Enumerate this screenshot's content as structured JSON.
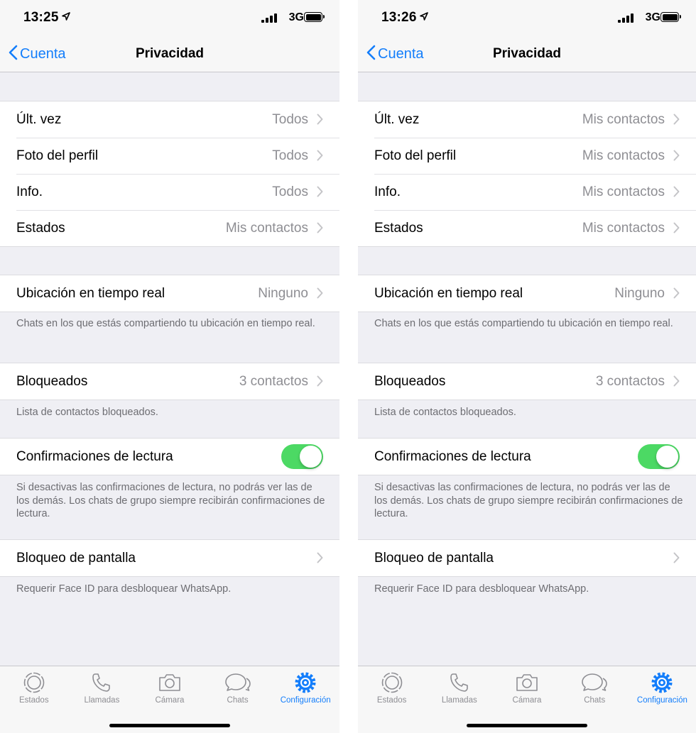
{
  "screens": [
    {
      "time": "13:25",
      "network": "3G",
      "back_label": "Cuenta",
      "title": "Privacidad",
      "privacy_rows": [
        {
          "label": "Últ. vez",
          "value": "Todos"
        },
        {
          "label": "Foto del perfil",
          "value": "Todos"
        },
        {
          "label": "Info.",
          "value": "Todos"
        },
        {
          "label": "Estados",
          "value": "Mis contactos"
        }
      ],
      "location": {
        "label": "Ubicación en tiempo real",
        "value": "Ninguno",
        "footnote": "Chats en los que estás compartiendo tu ubicación en tiempo real."
      },
      "blocked": {
        "label": "Bloqueados",
        "value": "3 contactos",
        "footnote": "Lista de contactos bloqueados."
      },
      "read_receipts": {
        "label": "Confirmaciones de lectura",
        "enabled": true,
        "footnote": "Si desactivas las confirmaciones de lectura, no podrás ver las de los demás. Los chats de grupo siempre recibirán confirmaciones de lectura."
      },
      "screen_lock": {
        "label": "Bloqueo de pantalla",
        "footnote": "Requerir Face ID para desbloquear WhatsApp."
      },
      "tabs": [
        {
          "label": "Estados",
          "icon": "status-icon",
          "active": false
        },
        {
          "label": "Llamadas",
          "icon": "phone-icon",
          "active": false
        },
        {
          "label": "Cámara",
          "icon": "camera-icon",
          "active": false
        },
        {
          "label": "Chats",
          "icon": "chats-icon",
          "active": false
        },
        {
          "label": "Configuración",
          "icon": "gear-icon",
          "active": true
        }
      ]
    },
    {
      "time": "13:26",
      "network": "3G",
      "back_label": "Cuenta",
      "title": "Privacidad",
      "privacy_rows": [
        {
          "label": "Últ. vez",
          "value": "Mis contactos"
        },
        {
          "label": "Foto del perfil",
          "value": "Mis contactos"
        },
        {
          "label": "Info.",
          "value": "Mis contactos"
        },
        {
          "label": "Estados",
          "value": "Mis contactos"
        }
      ],
      "location": {
        "label": "Ubicación en tiempo real",
        "value": "Ninguno",
        "footnote": "Chats en los que estás compartiendo tu ubicación en tiempo real."
      },
      "blocked": {
        "label": "Bloqueados",
        "value": "3 contactos",
        "footnote": "Lista de contactos bloqueados."
      },
      "read_receipts": {
        "label": "Confirmaciones de lectura",
        "enabled": true,
        "footnote": "Si desactivas las confirmaciones de lectura, no podrás ver las de los demás. Los chats de grupo siempre recibirán confirmaciones de lectura."
      },
      "screen_lock": {
        "label": "Bloqueo de pantalla",
        "footnote": "Requerir Face ID para desbloquear WhatsApp."
      },
      "tabs": [
        {
          "label": "Estados",
          "icon": "status-icon",
          "active": false
        },
        {
          "label": "Llamadas",
          "icon": "phone-icon",
          "active": false
        },
        {
          "label": "Cámara",
          "icon": "camera-icon",
          "active": false
        },
        {
          "label": "Chats",
          "icon": "chats-icon",
          "active": false
        },
        {
          "label": "Configuración",
          "icon": "gear-icon",
          "active": true
        }
      ]
    }
  ],
  "colors": {
    "accent": "#147efb",
    "toggle_on": "#4cd964",
    "secondary_text": "#8e8e93",
    "background": "#efeff4"
  }
}
